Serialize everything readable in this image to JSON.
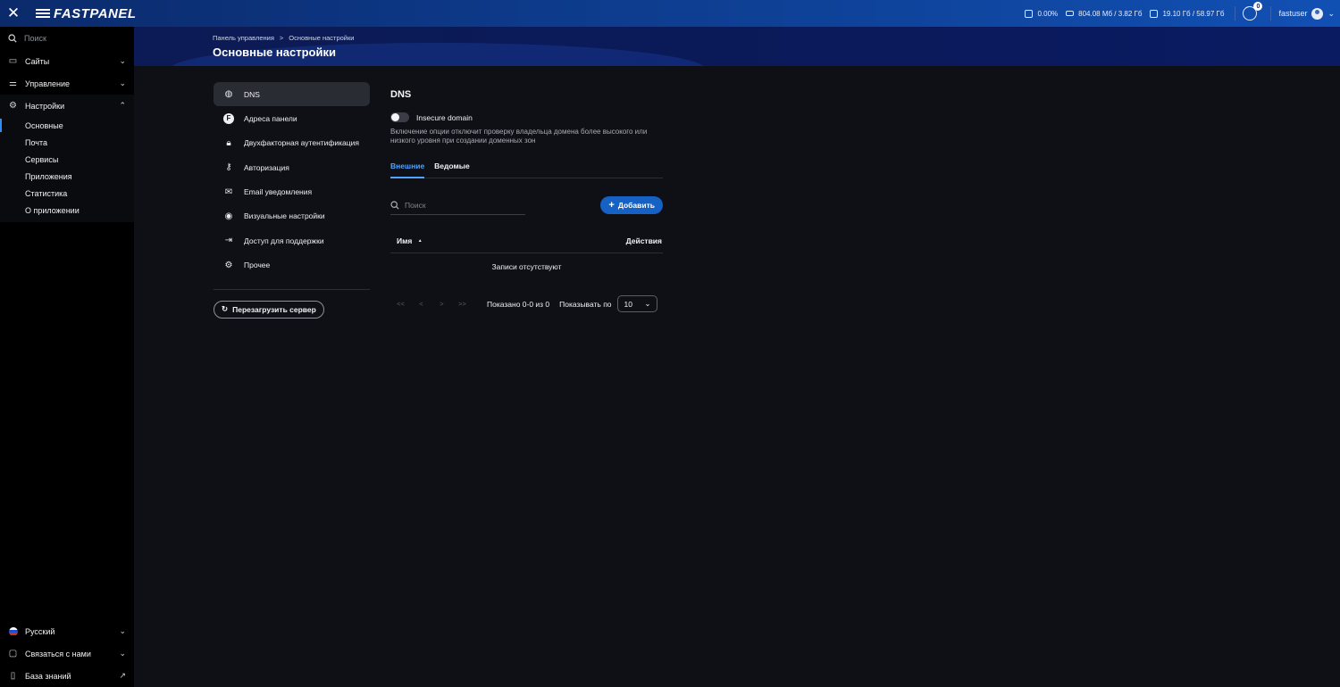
{
  "topbar": {
    "brand": "FASTPANEL",
    "cpu": "0.00%",
    "ram": "804.08 Мб / 3.82 Гб",
    "disk": "19.10 Гб / 58.97 Гб",
    "notifications": "0",
    "username": "fastuser"
  },
  "sidebar": {
    "search_placeholder": "Поиск",
    "items": [
      {
        "label": "Сайты"
      },
      {
        "label": "Управление"
      },
      {
        "label": "Настройки"
      }
    ],
    "settings_sub": [
      "Основные",
      "Почта",
      "Сервисы",
      "Приложения",
      "Статистика",
      "О приложении"
    ],
    "bottom": [
      {
        "label": "Русский"
      },
      {
        "label": "Связаться с нами"
      },
      {
        "label": "База знаний"
      }
    ]
  },
  "header": {
    "breadcrumb_root": "Панель управления",
    "breadcrumb_sep": ">",
    "breadcrumb_current": "Основные настройки",
    "title": "Основные настройки"
  },
  "settings_nav": {
    "items": [
      {
        "label": "DNS",
        "icon": "globe-icon"
      },
      {
        "label": "Адреса панели",
        "icon": "fastpanel-f-icon"
      },
      {
        "label": "Двухфакторная аутентификация",
        "icon": "lock-icon"
      },
      {
        "label": "Авторизация",
        "icon": "key-icon"
      },
      {
        "label": "Email уведомления",
        "icon": "envelope-icon"
      },
      {
        "label": "Визуальные настройки",
        "icon": "eye-icon"
      },
      {
        "label": "Доступ для поддержки",
        "icon": "login-arrow-icon"
      },
      {
        "label": "Прочее",
        "icon": "gear-icon"
      }
    ],
    "restart_label": "Перезагрузить сервер"
  },
  "dns": {
    "title": "DNS",
    "toggle_label": "Insecure domain",
    "toggle_on": false,
    "description": "Включение опции отключит проверку владельца домена более высокого или низкого уровня при создании доменных зон",
    "tabs": [
      "Внешние",
      "Ведомые"
    ],
    "active_tab": "Внешние",
    "search_placeholder": "Поиск",
    "add_label": "Добавить",
    "col_name": "Имя",
    "sort_indicator": "▲",
    "col_actions": "Действия",
    "empty_text": "Записи отсутствуют",
    "pager": {
      "first": "<<",
      "prev": "<",
      "next": ">",
      "last": ">>",
      "shown": "Показано 0-0 из 0",
      "per_page_label": "Показывать по",
      "per_page_value": "10"
    }
  },
  "colors": {
    "accent": "#1561c4",
    "active_tab": "#4da3ff",
    "topbar": "#0d3a8a"
  }
}
